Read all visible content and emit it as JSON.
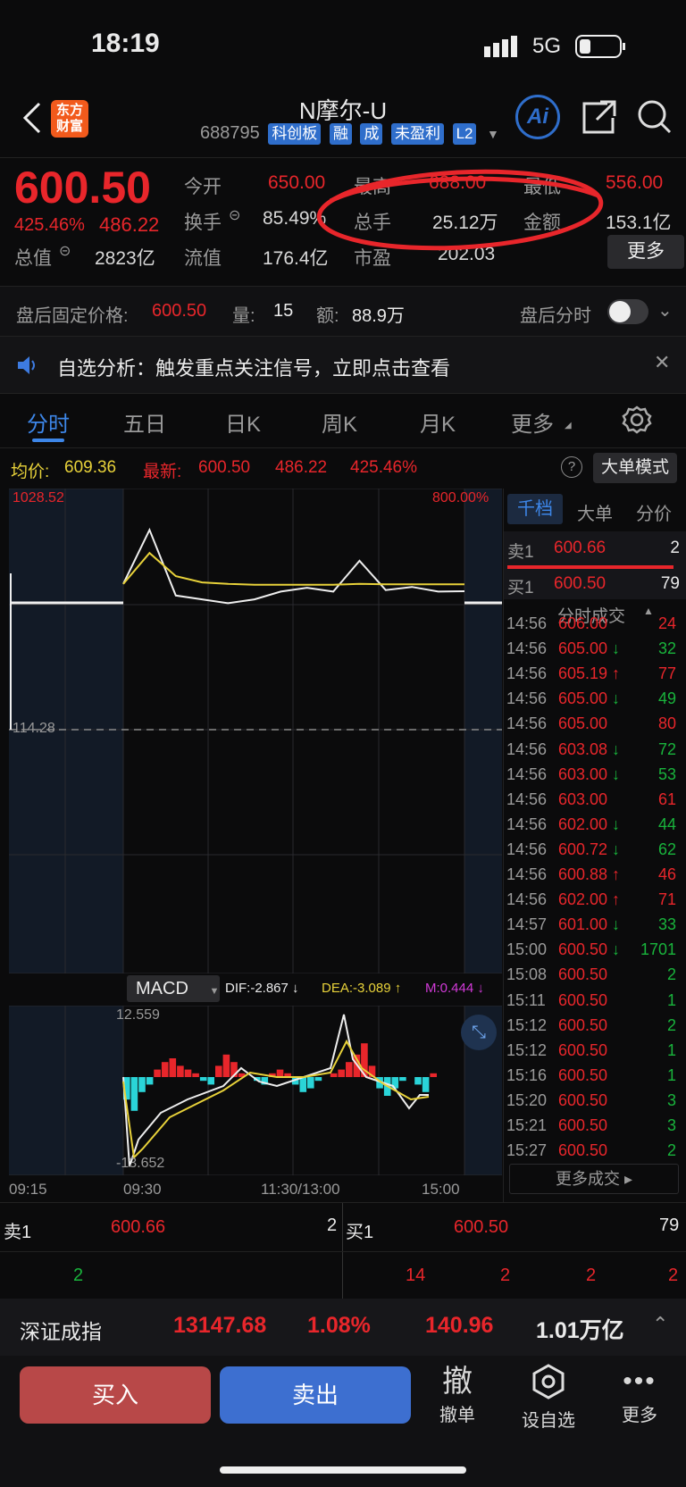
{
  "status_bar": {
    "time": "18:19",
    "network": "5G"
  },
  "header": {
    "brand_logo_line1": "东方",
    "brand_logo_line2": "财富",
    "title": "N摩尔-U",
    "code": "688795",
    "tags": [
      "科创板",
      "融",
      "成",
      "未盈利",
      "L2"
    ],
    "ai_label": "Ai"
  },
  "quote": {
    "price": "600.50",
    "change_pct": "425.46%",
    "change_abs": "486.22",
    "open_label": "今开",
    "open_value": "650.00",
    "high_label": "最高",
    "high_value": "688.00",
    "low_label": "最低",
    "low_value": "556.00",
    "turnover_label": "换手",
    "turnover_value": "85.49%",
    "volume_label": "总手",
    "volume_value": "25.12万",
    "amount_label": "金额",
    "amount_value": "153.1亿",
    "mktcap_label": "总值",
    "mktcap_value": "2823亿",
    "float_label": "流值",
    "float_value": "176.4亿",
    "pe_label": "市盈",
    "pe_value": "202.03",
    "more_button": "更多"
  },
  "after_hours": {
    "fixed_price_label": "盘后固定价格:",
    "fixed_price_value": "600.50",
    "volume_label": "量:",
    "volume_value": "15",
    "amount_label": "额:",
    "amount_value": "88.9万",
    "timeshare_label": "盘后分时"
  },
  "notice": {
    "text": "自选分析：触发重点关注信号，立即点击查看"
  },
  "tabs": [
    "分时",
    "五日",
    "日K",
    "周K",
    "月K",
    "更多"
  ],
  "chart_info": {
    "avg_label": "均价:",
    "avg_value": "609.36",
    "latest_label": "最新:",
    "latest_value": "600.50",
    "latest_change": "486.22",
    "latest_pct": "425.46%",
    "bigorder_button": "大单模式"
  },
  "chart_data": [
    {
      "type": "line",
      "name": "price",
      "y_top_label": "1028.52",
      "y_mid_label": "114.28",
      "y_right_top_label": "800.00%",
      "x_labels": [
        "09:15",
        "09:30",
        "11:30/13:00",
        "15:00"
      ],
      "series": [
        {
          "name": "price",
          "values": [
            610,
            680,
            595,
            590,
            585,
            590,
            600,
            605,
            600,
            640,
            602,
            606,
            600,
            600.5
          ]
        },
        {
          "name": "avg",
          "values": [
            610,
            650,
            620,
            612,
            610,
            609,
            609,
            609,
            609,
            610,
            609.5,
            609.4,
            609.36,
            609.36
          ]
        }
      ]
    },
    {
      "type": "bar",
      "name": "MACD",
      "indicator": "MACD",
      "dif_label": "DIF:-2.867",
      "dif_arrow": "↓",
      "dea_label": "DEA:-3.089",
      "dea_arrow": "↑",
      "m_label": "M:0.444",
      "m_arrow": "↓",
      "ylim": [
        -13.652,
        12.559
      ],
      "y_top_label": "12.559",
      "y_bottom_label": "-13.652",
      "values": [
        -6,
        -9,
        -4,
        -2,
        2,
        4,
        5,
        3,
        2,
        1,
        -1,
        -2,
        3,
        6,
        4,
        1,
        0,
        -1,
        -2,
        1,
        2,
        1,
        -2,
        -4,
        -3,
        -1,
        0,
        1,
        2,
        4,
        6,
        9,
        3,
        -3,
        -5,
        -3,
        -1,
        0,
        -2,
        -4,
        1
      ]
    }
  ],
  "order_book": {
    "tabs": [
      "千档",
      "大单",
      "分价"
    ],
    "sell1_label": "卖1",
    "sell1_price": "600.66",
    "sell1_vol": "2",
    "buy1_label": "买1",
    "buy1_price": "600.50",
    "buy1_vol": "79",
    "trades_header": "分时成交",
    "trades": [
      {
        "time": "14:56",
        "price": "606.00",
        "arrow": "",
        "vol": "24",
        "dir": "up"
      },
      {
        "time": "14:56",
        "price": "605.00",
        "arrow": "↓",
        "vol": "32",
        "dir": "down"
      },
      {
        "time": "14:56",
        "price": "605.19",
        "arrow": "↑",
        "vol": "77",
        "dir": "up"
      },
      {
        "time": "14:56",
        "price": "605.00",
        "arrow": "↓",
        "vol": "49",
        "dir": "down"
      },
      {
        "time": "14:56",
        "price": "605.00",
        "arrow": "",
        "vol": "80",
        "dir": "up"
      },
      {
        "time": "14:56",
        "price": "603.08",
        "arrow": "↓",
        "vol": "72",
        "dir": "down"
      },
      {
        "time": "14:56",
        "price": "603.00",
        "arrow": "↓",
        "vol": "53",
        "dir": "down"
      },
      {
        "time": "14:56",
        "price": "603.00",
        "arrow": "",
        "vol": "61",
        "dir": "up"
      },
      {
        "time": "14:56",
        "price": "602.00",
        "arrow": "↓",
        "vol": "44",
        "dir": "down"
      },
      {
        "time": "14:56",
        "price": "600.72",
        "arrow": "↓",
        "vol": "62",
        "dir": "down"
      },
      {
        "time": "14:56",
        "price": "600.88",
        "arrow": "↑",
        "vol": "46",
        "dir": "up"
      },
      {
        "time": "14:56",
        "price": "602.00",
        "arrow": "↑",
        "vol": "71",
        "dir": "up"
      },
      {
        "time": "14:57",
        "price": "601.00",
        "arrow": "↓",
        "vol": "33",
        "dir": "down"
      },
      {
        "time": "15:00",
        "price": "600.50",
        "arrow": "↓",
        "vol": "1701",
        "dir": "down"
      },
      {
        "time": "15:08",
        "price": "600.50",
        "arrow": "",
        "vol": "2",
        "dir": "down"
      },
      {
        "time": "15:11",
        "price": "600.50",
        "arrow": "",
        "vol": "1",
        "dir": "down"
      },
      {
        "time": "15:12",
        "price": "600.50",
        "arrow": "",
        "vol": "2",
        "dir": "down"
      },
      {
        "time": "15:12",
        "price": "600.50",
        "arrow": "",
        "vol": "1",
        "dir": "down"
      },
      {
        "time": "15:16",
        "price": "600.50",
        "arrow": "",
        "vol": "1",
        "dir": "down"
      },
      {
        "time": "15:20",
        "price": "600.50",
        "arrow": "",
        "vol": "3",
        "dir": "down"
      },
      {
        "time": "15:21",
        "price": "600.50",
        "arrow": "",
        "vol": "3",
        "dir": "down"
      },
      {
        "time": "15:27",
        "price": "600.50",
        "arrow": "",
        "vol": "2",
        "dir": "down"
      }
    ],
    "more_trades": "更多成交"
  },
  "bottom_book": {
    "sell_label": "卖1",
    "sell_price": "600.66",
    "sell_vol": "2",
    "buy_label": "买1",
    "buy_price": "600.50",
    "buy_vol": "79",
    "row2_left": "2",
    "row2_right": [
      "14",
      "2",
      "2",
      "2"
    ]
  },
  "index_bar": {
    "name": "深证成指",
    "value": "13147.68",
    "pct": "1.08%",
    "change": "140.96",
    "amount": "1.01万亿"
  },
  "actions": {
    "buy": "买入",
    "sell": "卖出",
    "cancel_icon": "撤",
    "cancel": "撤单",
    "watch": "设自选",
    "more": "更多"
  },
  "colors": {
    "up": "#e8262b",
    "down": "#19b43c",
    "accent": "#2f6ecb",
    "avg_line": "#e8d23a"
  }
}
